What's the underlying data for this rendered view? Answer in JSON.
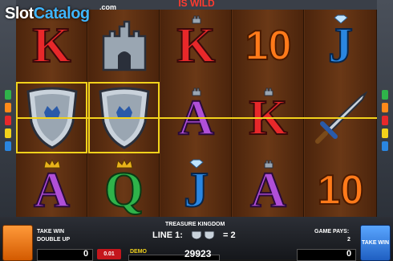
{
  "banner": {
    "text": "IS WILD"
  },
  "logo": {
    "part1": "Slot",
    "part2": "Catalog",
    "com": ".com"
  },
  "reels": [
    [
      "K",
      "shield",
      "A"
    ],
    [
      "castle",
      "shield",
      "Q"
    ],
    [
      "K",
      "A",
      "J"
    ],
    [
      "10",
      "K",
      "A"
    ],
    [
      "J",
      "sword",
      "10"
    ]
  ],
  "symbols": {
    "K": {
      "text": "K",
      "color": "#e8282a"
    },
    "A": {
      "text": "A",
      "color": "#b04fd8"
    },
    "Q": {
      "text": "Q",
      "color": "#2fb34a"
    },
    "J": {
      "text": "J",
      "color": "#2a86e0"
    },
    "10": {
      "text": "10",
      "color": "#ff7a1a"
    }
  },
  "footer": {
    "game_title": "TREASURE KINGDOM",
    "take_win": "TAKE WIN",
    "double_up": "DOUBLE UP",
    "line_label": "LINE 1:",
    "line_eq": "= 2",
    "game_pays_label": "GAME PAYS:",
    "game_pays_value": "2",
    "take_win_button": "TAKE WIN",
    "bet_value": "0",
    "coin_value": "0.01",
    "demo_label": "DEMO",
    "credit_value": "29923",
    "win_value": "0"
  },
  "colors": {
    "payline": "#f2d21b",
    "reel_bg": "#5a2e12"
  }
}
